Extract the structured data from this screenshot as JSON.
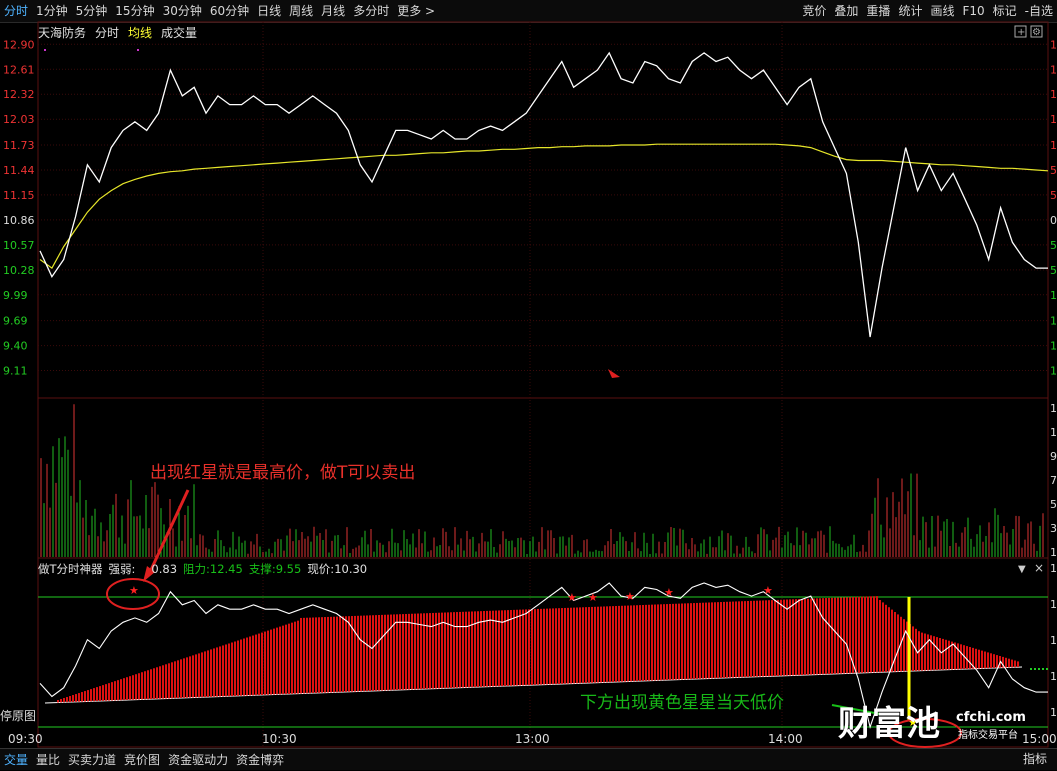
{
  "toolbar": {
    "periods": [
      {
        "label": "分时",
        "active": true
      },
      {
        "label": "1分钟"
      },
      {
        "label": "5分钟"
      },
      {
        "label": "15分钟"
      },
      {
        "label": "30分钟"
      },
      {
        "label": "60分钟"
      },
      {
        "label": "日线"
      },
      {
        "label": "周线"
      },
      {
        "label": "月线"
      },
      {
        "label": "多分时"
      },
      {
        "label": "更多 >"
      }
    ],
    "tools": [
      "竞价",
      "叠加",
      "重播",
      "统计",
      "画线",
      "F10",
      "标记",
      "-自选"
    ]
  },
  "stock": {
    "name": "天海防务",
    "tabs": [
      "分时",
      "均线",
      "成交量"
    ]
  },
  "price_axis": {
    "labels": [
      "12.90",
      "12.61",
      "12.32",
      "12.03",
      "11.73",
      "11.44",
      "11.15",
      "10.86",
      "10.57",
      "10.28",
      "9.99",
      "9.69",
      "9.40",
      "9.11"
    ],
    "right_labels": [
      "1",
      "1",
      "1",
      "1",
      "1",
      "5",
      "5",
      "0",
      "5",
      "5",
      "1",
      "1",
      "1",
      "1"
    ],
    "vol_right_labels": [
      "1",
      "1",
      "9",
      "7",
      "5",
      "3",
      "1"
    ],
    "ind_right_labels": [
      "1",
      "1",
      "1",
      "1",
      "1"
    ]
  },
  "indicator": {
    "name": "做T分时神器",
    "strength_label": "强弱:",
    "strength_value": "0.83",
    "resist_label": "阻力:",
    "resist_value": "12.45",
    "support_label": "支撑:",
    "support_value": "9.55",
    "price_label": "现价:",
    "price_value": "10.30"
  },
  "left_label": "停原图",
  "time_axis": [
    "09:30",
    "10:30",
    "13:00",
    "14:00",
    "15:00"
  ],
  "annotations": {
    "red_note": "出现红星就是最高价，做T可以卖出",
    "green_note": "下方出现黄色星星当天低价"
  },
  "watermark": {
    "brand": "财富池",
    "site": "cfchi.com",
    "slogan": "指标交易平台"
  },
  "bottom_tabs": [
    {
      "label": "交量",
      "active": true
    },
    {
      "label": "量比"
    },
    {
      "label": "买卖力道"
    },
    {
      "label": "竞价图"
    },
    {
      "label": "资金驱动力"
    },
    {
      "label": "资金博弈"
    }
  ],
  "bottom_right": "指标",
  "chart_data": {
    "type": "line",
    "x_axis_ticks": [
      "09:30",
      "10:30",
      "13:00",
      "14:00",
      "15:00"
    ],
    "price": [
      10.5,
      10.2,
      10.4,
      10.9,
      11.5,
      11.3,
      11.7,
      11.9,
      12.0,
      11.9,
      12.1,
      12.6,
      12.3,
      12.4,
      12.1,
      12.3,
      12.2,
      12.2,
      12.3,
      12.2,
      12.2,
      12.1,
      12.2,
      12.3,
      12.2,
      12.1,
      11.9,
      11.5,
      11.3,
      11.6,
      11.9,
      11.9,
      11.85,
      11.8,
      11.9,
      11.8,
      11.8,
      11.9,
      11.95,
      11.9,
      12.0,
      12.1,
      12.3,
      12.5,
      12.7,
      12.4,
      12.5,
      12.6,
      12.8,
      12.5,
      12.45,
      12.7,
      12.65,
      12.5,
      12.45,
      12.7,
      12.8,
      12.7,
      12.75,
      12.6,
      12.5,
      12.6,
      12.4,
      12.2,
      12.4,
      12.5,
      12.0,
      11.7,
      11.4,
      10.6,
      9.5,
      10.3,
      11.0,
      11.7,
      11.2,
      11.5,
      11.2,
      11.4,
      11.1,
      10.8,
      10.4,
      11.0,
      10.6,
      10.4,
      10.3,
      10.3
    ],
    "avg_price": [
      10.4,
      10.3,
      10.55,
      10.75,
      10.95,
      11.1,
      11.2,
      11.28,
      11.33,
      11.37,
      11.4,
      11.42,
      11.43,
      11.45,
      11.46,
      11.47,
      11.48,
      11.49,
      11.5,
      11.51,
      11.52,
      11.53,
      11.54,
      11.55,
      11.56,
      11.57,
      11.58,
      11.59,
      11.6,
      11.61,
      11.61,
      11.62,
      11.63,
      11.64,
      11.64,
      11.65,
      11.66,
      11.66,
      11.67,
      11.68,
      11.68,
      11.69,
      11.7,
      11.7,
      11.71,
      11.71,
      11.72,
      11.72,
      11.72,
      11.73,
      11.73,
      11.73,
      11.74,
      11.74,
      11.74,
      11.74,
      11.74,
      11.74,
      11.74,
      11.74,
      11.74,
      11.74,
      11.74,
      11.73,
      11.72,
      11.7,
      11.65,
      11.6,
      11.56,
      11.55,
      11.55,
      11.55,
      11.54,
      11.53,
      11.52,
      11.51,
      11.5,
      11.5,
      11.49,
      11.48,
      11.47,
      11.46,
      11.46,
      11.45,
      11.44,
      11.43
    ],
    "ylim": [
      9.0,
      12.95
    ]
  }
}
